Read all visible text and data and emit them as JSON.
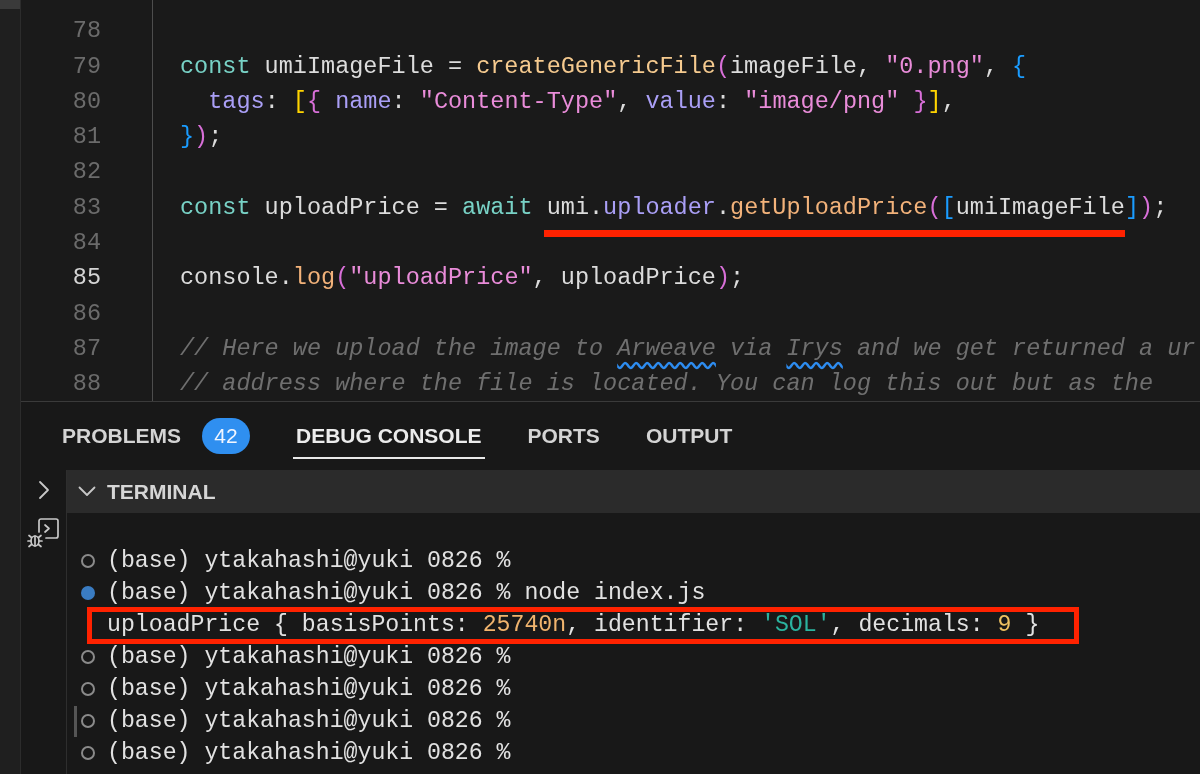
{
  "editor": {
    "lines": [
      {
        "number": "78",
        "active": false
      },
      {
        "number": "79",
        "active": false,
        "tokens": [
          {
            "kind": "keyword",
            "text": "const"
          },
          {
            "kind": "plain",
            "text": " umiImageFile = "
          },
          {
            "kind": "function",
            "text": "createGenericFile"
          },
          {
            "kind": "bracket",
            "color": "#d86fd8",
            "text": "("
          },
          {
            "kind": "plain",
            "text": "imageFile, "
          },
          {
            "kind": "string",
            "text": "\"0.png\""
          },
          {
            "kind": "plain",
            "text": ", "
          },
          {
            "kind": "bracket",
            "color": "#1a9cff",
            "text": "{"
          }
        ]
      },
      {
        "number": "80",
        "active": false,
        "tokens": [
          {
            "kind": "property",
            "text": "  tags"
          },
          {
            "kind": "plain",
            "text": ": "
          },
          {
            "kind": "bracket",
            "color": "#ffd400",
            "text": "["
          },
          {
            "kind": "bracket",
            "color": "#d86fd8",
            "text": "{"
          },
          {
            "kind": "property",
            "text": " name"
          },
          {
            "kind": "plain",
            "text": ": "
          },
          {
            "kind": "string",
            "text": "\"Content-Type\""
          },
          {
            "kind": "plain",
            "text": ", "
          },
          {
            "kind": "property",
            "text": "value"
          },
          {
            "kind": "plain",
            "text": ": "
          },
          {
            "kind": "string",
            "text": "\"image/png\""
          },
          {
            "kind": "bracket",
            "color": "#d86fd8",
            "text": " }"
          },
          {
            "kind": "bracket",
            "color": "#ffd400",
            "text": "]"
          },
          {
            "kind": "plain",
            "text": ","
          }
        ]
      },
      {
        "number": "81",
        "active": false,
        "tokens": [
          {
            "kind": "bracket",
            "color": "#1a9cff",
            "text": "}"
          },
          {
            "kind": "bracket",
            "color": "#d86fd8",
            "text": ")"
          },
          {
            "kind": "plain",
            "text": ";"
          }
        ]
      },
      {
        "number": "82",
        "active": false
      },
      {
        "number": "83",
        "active": false,
        "tokens": [
          {
            "kind": "keyword",
            "text": "const"
          },
          {
            "kind": "plain",
            "text": " uploadPrice = "
          },
          {
            "kind": "keyword",
            "text": "await"
          },
          {
            "kind": "plain",
            "text": " umi."
          },
          {
            "kind": "property",
            "text": "uploader"
          },
          {
            "kind": "plain",
            "text": "."
          },
          {
            "kind": "method",
            "text": "getUploadPrice"
          },
          {
            "kind": "bracket",
            "color": "#d86fd8",
            "text": "("
          },
          {
            "kind": "bracket",
            "color": "#1a9cff",
            "text": "["
          },
          {
            "kind": "plain",
            "text": "umiImageFile"
          },
          {
            "kind": "bracket",
            "color": "#1a9cff",
            "text": "]"
          },
          {
            "kind": "bracket",
            "color": "#d86fd8",
            "text": ")"
          },
          {
            "kind": "plain",
            "text": ";"
          }
        ]
      },
      {
        "number": "84",
        "active": false
      },
      {
        "number": "85",
        "active": true,
        "tokens": [
          {
            "kind": "plain",
            "text": "console."
          },
          {
            "kind": "method",
            "text": "log"
          },
          {
            "kind": "bracket",
            "color": "#d86fd8",
            "text": "("
          },
          {
            "kind": "string",
            "text": "\"uploadPrice\""
          },
          {
            "kind": "plain",
            "text": ", uploadPrice"
          },
          {
            "kind": "bracket",
            "color": "#d86fd8",
            "text": ")"
          },
          {
            "kind": "plain",
            "text": ";"
          }
        ]
      },
      {
        "number": "86",
        "active": false
      },
      {
        "number": "87",
        "active": false,
        "tokens": [
          {
            "kind": "comment",
            "text": "// Here we upload the image to "
          },
          {
            "kind": "flagged",
            "text": "Arweave"
          },
          {
            "kind": "comment",
            "text": " via "
          },
          {
            "kind": "flagged",
            "text": "Irys"
          },
          {
            "kind": "comment",
            "text": " and we get returned a ur"
          }
        ]
      },
      {
        "number": "88",
        "active": false,
        "tokens": [
          {
            "kind": "comment",
            "text": "// address where the file is located. You can log this out but as the"
          }
        ]
      }
    ]
  },
  "panel": {
    "tabs": [
      {
        "label": "PROBLEMS",
        "selected": false,
        "badge": "42"
      },
      {
        "label": "DEBUG CONSOLE",
        "selected": true
      },
      {
        "label": "PORTS",
        "selected": false
      },
      {
        "label": "OUTPUT",
        "selected": false
      }
    ]
  },
  "terminal": {
    "title": "TERMINAL",
    "expanded": true,
    "lines": [
      {
        "kind": "prompt",
        "succeeded": false,
        "marked": false,
        "highlighted": false,
        "text": "(base) ytakahashi@yuki 0826 %"
      },
      {
        "kind": "prompt",
        "succeeded": true,
        "marked": false,
        "highlighted": false,
        "text": "(base) ytakahashi@yuki 0826 % node index.js"
      },
      {
        "kind": "output",
        "highlighted": true,
        "tokens": [
          {
            "kind": "plain",
            "text": "uploadPrice { basisPoints: "
          },
          {
            "kind": "bigint",
            "text": "25740n"
          },
          {
            "kind": "plain",
            "text": ", identifier: "
          },
          {
            "kind": "string",
            "text": "'SOL'"
          },
          {
            "kind": "plain",
            "text": ", decimals: "
          },
          {
            "kind": "number",
            "text": "9"
          },
          {
            "kind": "plain",
            "text": " }"
          }
        ]
      },
      {
        "kind": "prompt",
        "succeeded": false,
        "marked": false,
        "highlighted": false,
        "text": "(base) ytakahashi@yuki 0826 %"
      },
      {
        "kind": "prompt",
        "succeeded": false,
        "marked": false,
        "highlighted": false,
        "text": "(base) ytakahashi@yuki 0826 %"
      },
      {
        "kind": "prompt",
        "succeeded": false,
        "marked": true,
        "highlighted": false,
        "text": "(base) ytakahashi@yuki 0826 %"
      },
      {
        "kind": "prompt",
        "succeeded": false,
        "marked": false,
        "highlighted": false,
        "text": "(base) ytakahashi@yuki 0826 %"
      }
    ]
  }
}
